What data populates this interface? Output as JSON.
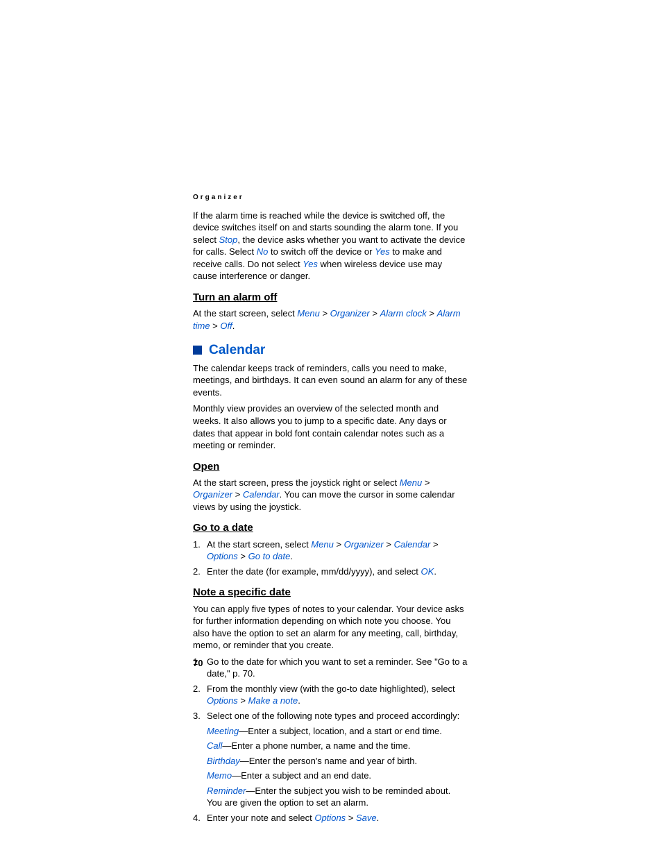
{
  "header": "Organizer",
  "intro": {
    "t1": "If the alarm time is reached while the device is switched off, the device switches itself on and starts sounding the alarm tone. If you select ",
    "stop": "Stop",
    "t2": ", the device asks whether you want to activate the device for calls. Select ",
    "no": "No",
    "t3": " to switch off the device or ",
    "yes1": "Yes",
    "t4": " to make and receive calls. Do not select ",
    "yes2": "Yes",
    "t5": " when wireless device use may cause interference or danger."
  },
  "turnOff": {
    "title": "Turn an alarm off",
    "lead": "At the start screen, select ",
    "path": [
      "Menu",
      "Organizer",
      "Alarm clock",
      "Alarm time",
      "Off"
    ],
    "dot": "."
  },
  "calendar": {
    "title": "Calendar",
    "p1": "The calendar keeps track of reminders, calls you need to make, meetings, and birthdays. It can even sound an alarm for any of these events.",
    "p2": "Monthly view provides an overview of the selected month and weeks. It also allows you to jump to a specific date. Any days or dates that appear in bold font contain calendar notes such as a meeting or reminder."
  },
  "open": {
    "title": "Open",
    "lead": "At the start screen, press the joystick right or select ",
    "path": [
      "Menu",
      "Organizer",
      "Calendar"
    ],
    "tail": ". You can move the cursor in some calendar views by using the joystick."
  },
  "goDate": {
    "title": "Go to a date",
    "li1_lead": "At the start screen, select ",
    "li1_path": [
      "Menu",
      "Organizer",
      "Calendar",
      "Options",
      "Go to date"
    ],
    "li1_dot": ".",
    "li2_a": "Enter the date (for example, mm/dd/yyyy), and select ",
    "li2_ok": "OK",
    "li2_dot": "."
  },
  "note": {
    "title": "Note a specific date",
    "p1": "You can apply five types of notes to your calendar. Your device asks for further information depending on which note you choose. You also have the option to set an alarm for any meeting, call, birthday, memo, or reminder that you create.",
    "li1": "Go to the date for which you want to set a reminder. See \"Go to a date,\" p. 70.",
    "li2_a": "From the monthly view (with the go-to date highlighted), select ",
    "li2_opt": "Options",
    "li2_gt": " > ",
    "li2_make": "Make a note",
    "li2_dot": ".",
    "li3_intro": "Select one of the following note types and proceed accordingly:",
    "types": {
      "meeting_k": "Meeting",
      "meeting_v": "—Enter a subject, location, and a start or end time.",
      "call_k": "Call",
      "call_v": "—Enter a phone number, a name and the time.",
      "birthday_k": "Birthday",
      "birthday_v": "—Enter the person's name and year of birth.",
      "memo_k": "Memo",
      "memo_v": "—Enter a subject and an end date.",
      "reminder_k": "Reminder",
      "reminder_v": "—Enter the subject you wish to be reminded about. You are given the option to set an alarm."
    },
    "li4_a": "Enter your note and select ",
    "li4_opt": "Options",
    "li4_gt": " > ",
    "li4_save": "Save",
    "li4_dot": "."
  },
  "pageNumber": "70"
}
